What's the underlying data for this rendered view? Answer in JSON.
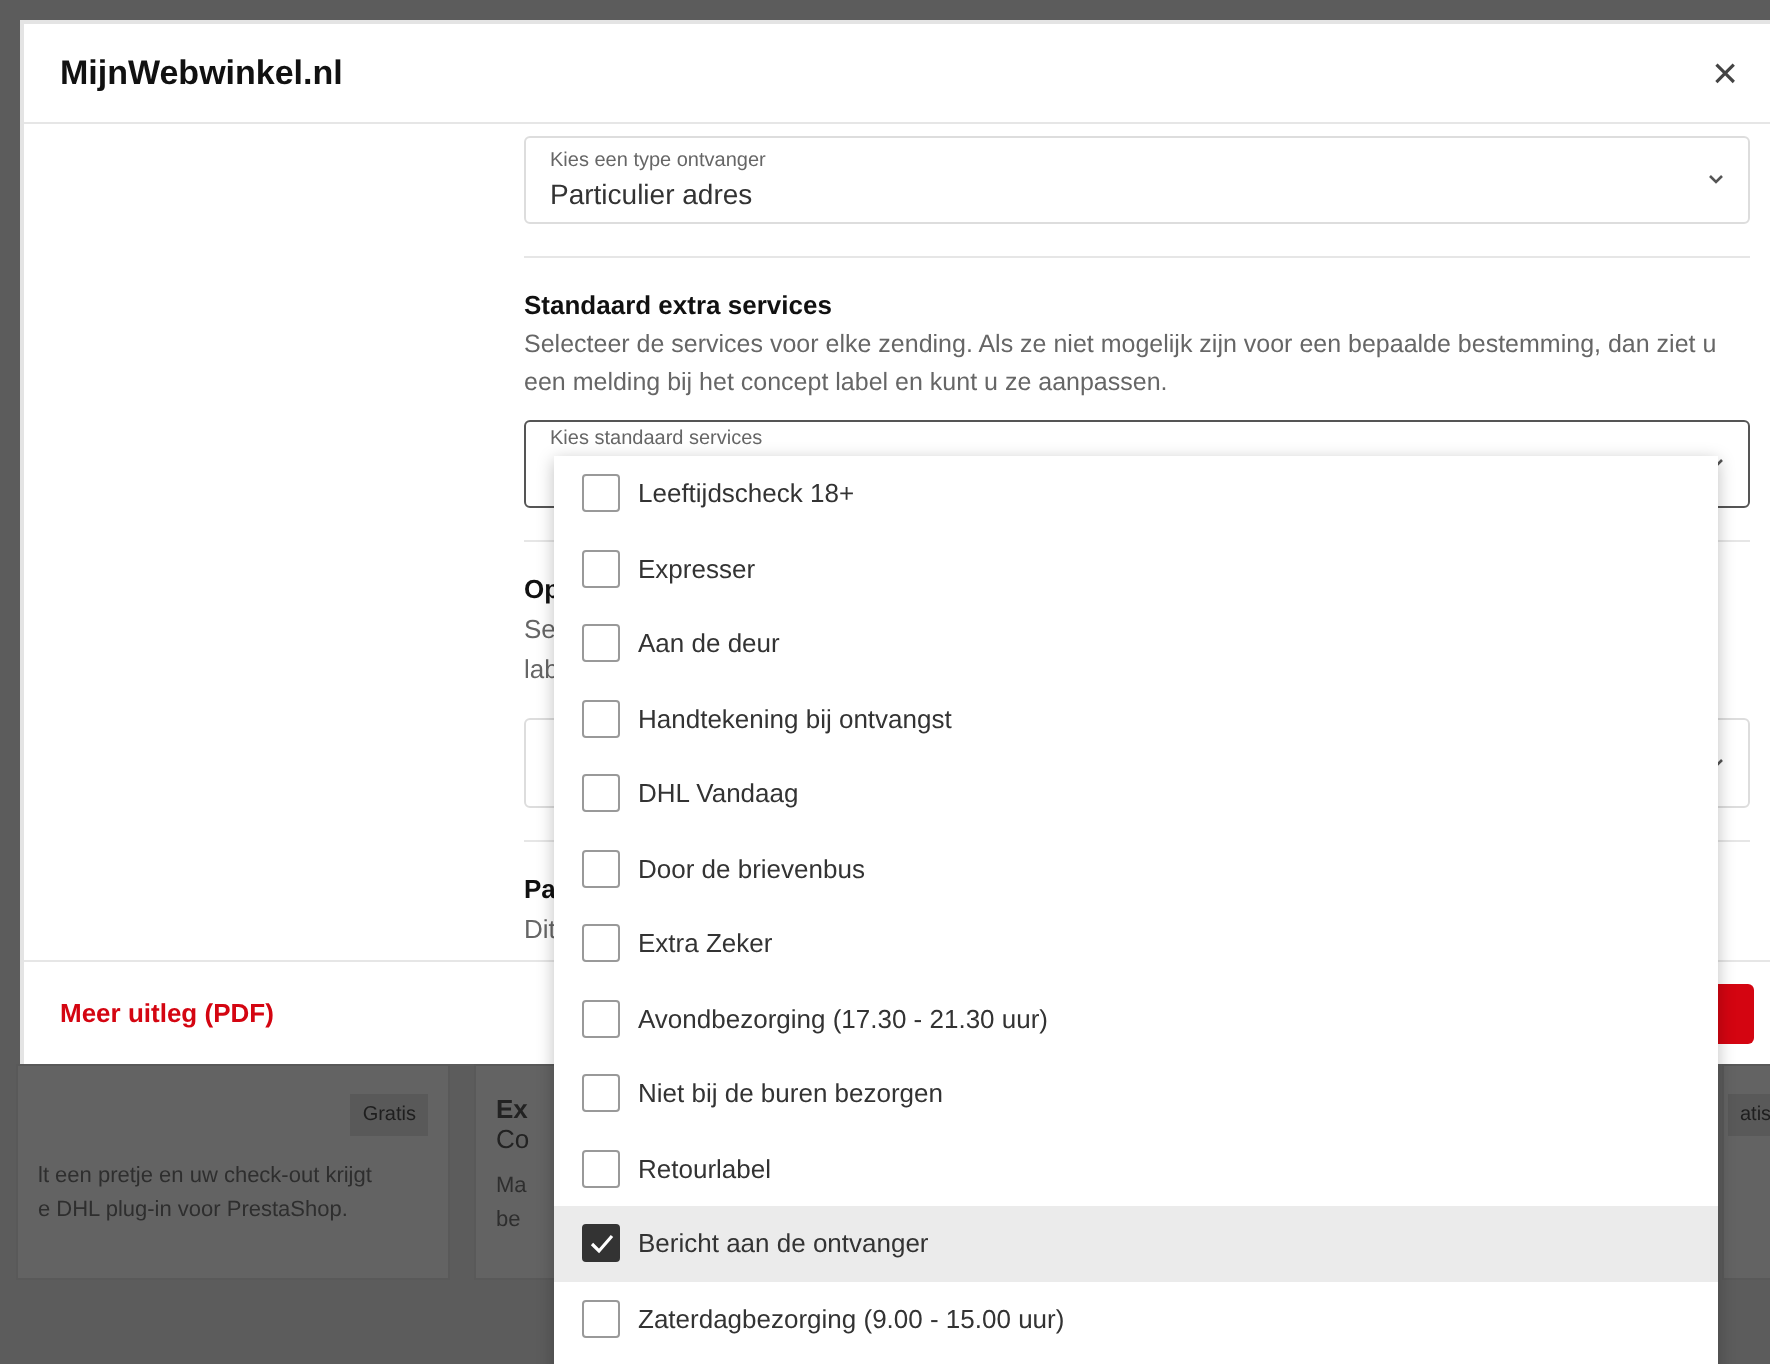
{
  "dialog": {
    "title": "MijnWebwinkel.nl",
    "close": "×",
    "recipient_select": {
      "label": "Kies een type ontvanger",
      "value": "Particulier adres"
    },
    "services_section": {
      "heading": "Standaard extra services",
      "description": "Selecteer de services voor elke zending. Als ze niet mogelijk zijn voor een bepaalde bestemming, dan ziet u een melding bij het concept label en kunt u ze aanpassen.",
      "select_label": "Kies standaard services"
    },
    "hidden_section_1": {
      "heading": "Op",
      "description_lines": [
        "Se",
        "lab"
      ]
    },
    "hidden_section_2": {
      "heading": "Pa",
      "description_lines": [
        "Dit"
      ]
    },
    "footer": {
      "link": "Meer uitleg (PDF)"
    }
  },
  "background_cards": [
    {
      "badge": "Gratis",
      "lines": [
        "lt een pretje en uw check-out krijgt",
        "e DHL plug-in voor PrestaShop."
      ]
    },
    {
      "title": "Ex",
      "subtitle": "Co",
      "lines": [
        "Ma",
        "be"
      ]
    },
    {
      "badge": "atis"
    }
  ],
  "services_dropdown": [
    {
      "label": "Leeftijdscheck 18+",
      "checked": false,
      "selected": false
    },
    {
      "label": "Expresser",
      "checked": false,
      "selected": false
    },
    {
      "label": "Aan de deur",
      "checked": false,
      "selected": false
    },
    {
      "label": "Handtekening bij ontvangst",
      "checked": false,
      "selected": false
    },
    {
      "label": "DHL Vandaag",
      "checked": false,
      "selected": false
    },
    {
      "label": "Door de brievenbus",
      "checked": false,
      "selected": false
    },
    {
      "label": "Extra Zeker",
      "checked": false,
      "selected": false
    },
    {
      "label": "Avondbezorging (17.30 - 21.30 uur)",
      "checked": false,
      "selected": false
    },
    {
      "label": "Niet bij de buren bezorgen",
      "checked": false,
      "selected": false
    },
    {
      "label": "Retourlabel",
      "checked": false,
      "selected": false
    },
    {
      "label": "Bericht aan de ontvanger",
      "checked": true,
      "selected": true
    },
    {
      "label": "Zaterdagbezorging (9.00 - 15.00 uur)",
      "checked": false,
      "selected": false
    }
  ]
}
